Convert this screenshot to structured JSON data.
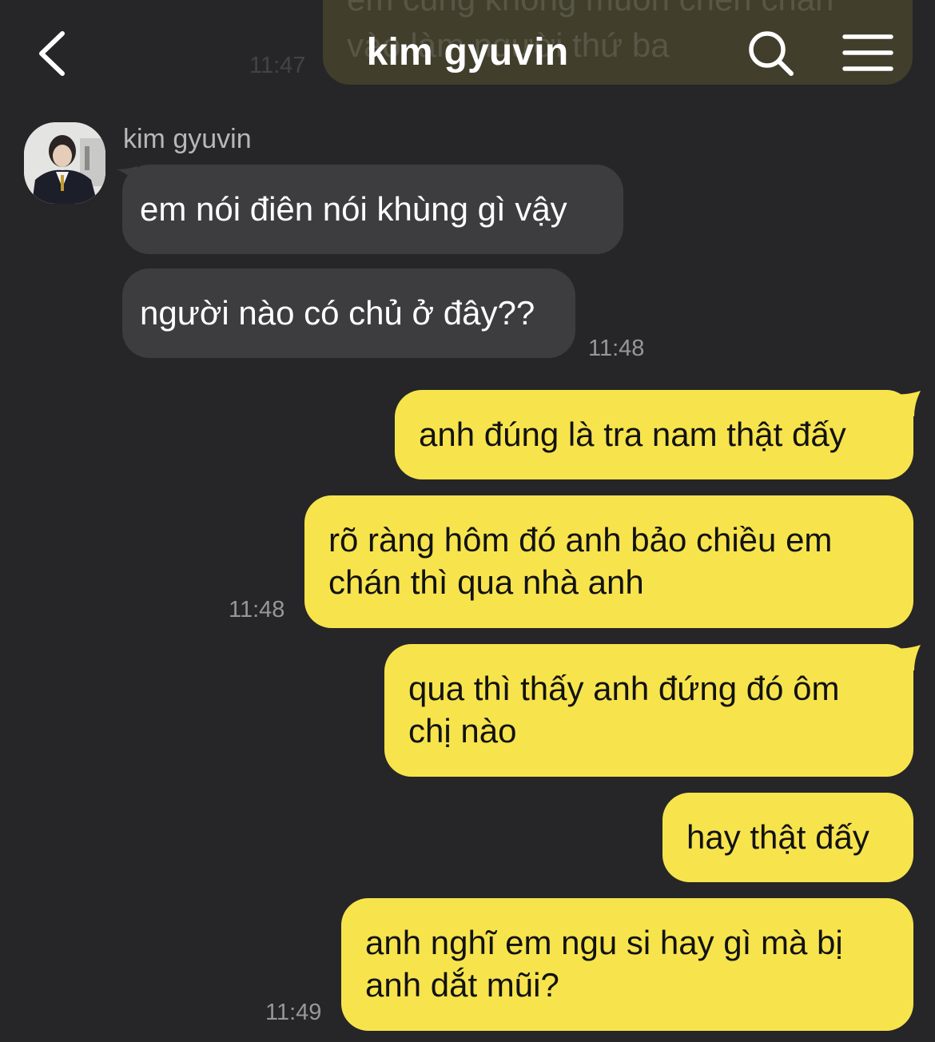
{
  "header": {
    "title": "kim gyuvin",
    "back_icon": "chevron-left-icon",
    "search_icon": "search-icon",
    "menu_icon": "hamburger-menu-icon"
  },
  "previous": {
    "text": "em cũng không muốn chen chân\nvào làm người thứ ba",
    "time": "11:47"
  },
  "incoming": {
    "sender": "kim gyuvin",
    "messages": [
      "em nói điên nói khùng gì vậy",
      "người nào có chủ ở đây??"
    ],
    "time": "11:48"
  },
  "outgoing": {
    "group1": {
      "messages": [
        "anh đúng là tra nam thật đấy",
        "rõ ràng hôm đó anh bảo chiều em\nchán thì qua nhà anh"
      ],
      "time": "11:48"
    },
    "group2": {
      "messages": [
        "qua thì thấy anh đứng đó ôm\nchị nào",
        "hay thật đấy",
        "anh nghĩ em ngu si hay gì mà bị\nanh dắt mũi?"
      ],
      "time": "11:49"
    }
  },
  "colors": {
    "background": "#262628",
    "incoming_bubble": "#3d3d40",
    "outgoing_bubble": "#f7e44d",
    "timestamp": "#97979a"
  }
}
